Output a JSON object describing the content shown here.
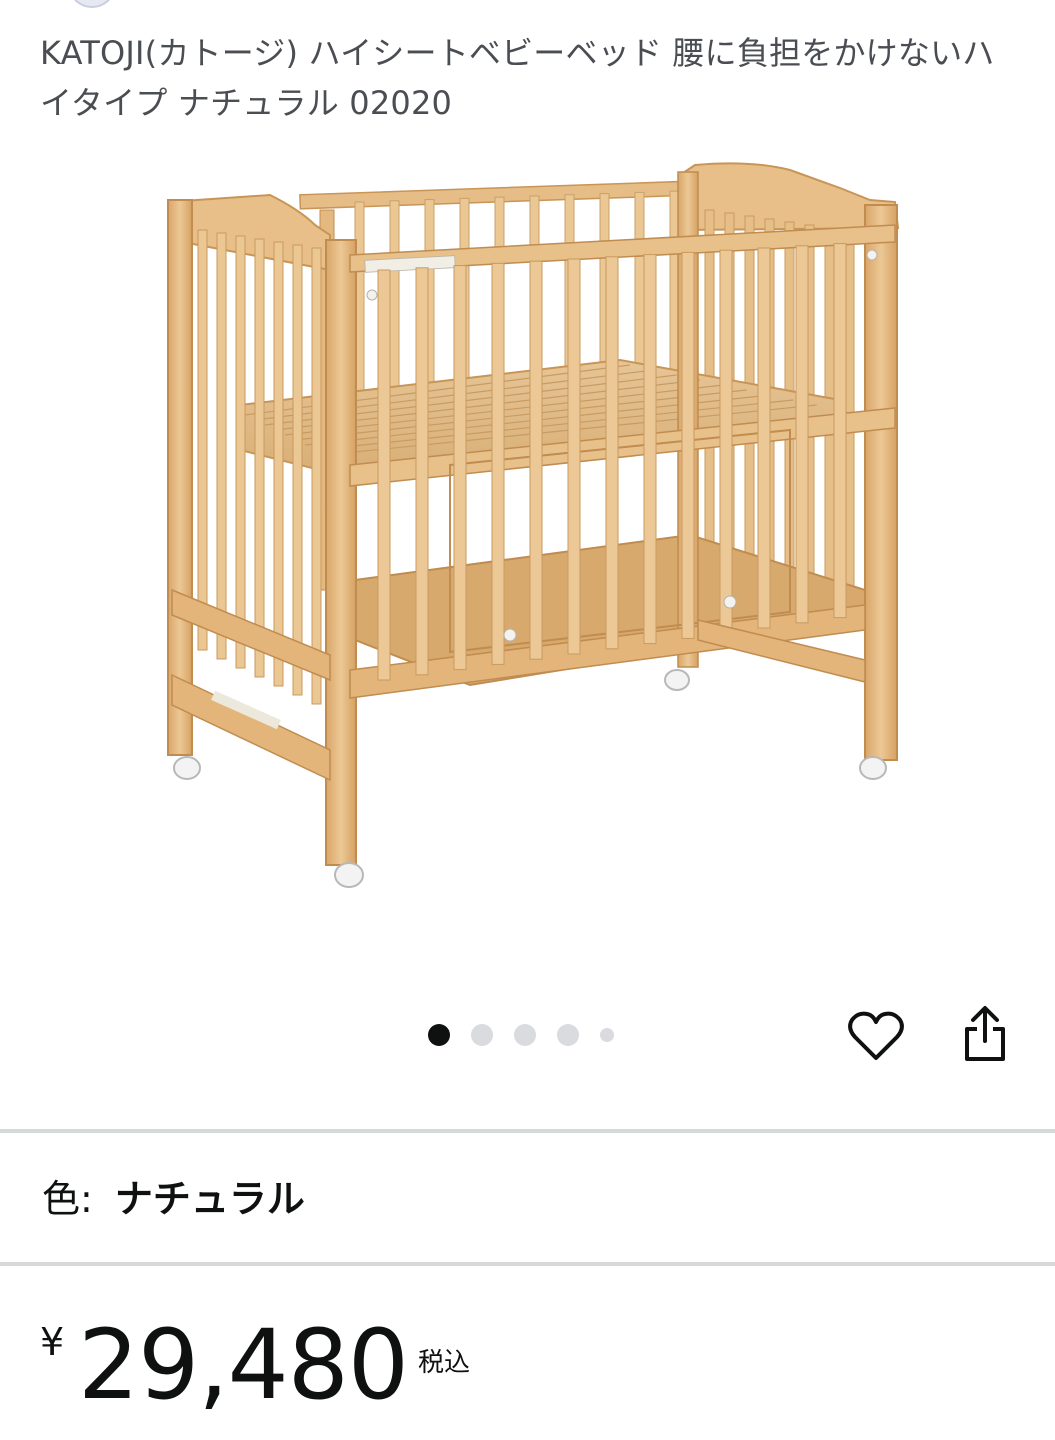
{
  "product": {
    "title": "KATOJI(カトージ) ハイシートベビーベッド 腰に負担をかけないハイタイプ ナチュラル 02020",
    "image": {
      "icon": "wooden-baby-crib-photo"
    }
  },
  "carousel": {
    "total_dots": 5,
    "active_index": 0
  },
  "actions": {
    "like_icon": "heart-outline-icon",
    "share_icon": "share-upload-icon"
  },
  "variation": {
    "label": "色:",
    "value": "ナチュラル"
  },
  "price": {
    "currency": "¥",
    "amount": "29,480",
    "tax_note": "税込"
  },
  "colors": {
    "wood": "#e4bb85",
    "wood_dark": "#c99a5e",
    "divider": "#d5d9d9",
    "text": "#0f1111",
    "title_text": "#4a4d52"
  }
}
